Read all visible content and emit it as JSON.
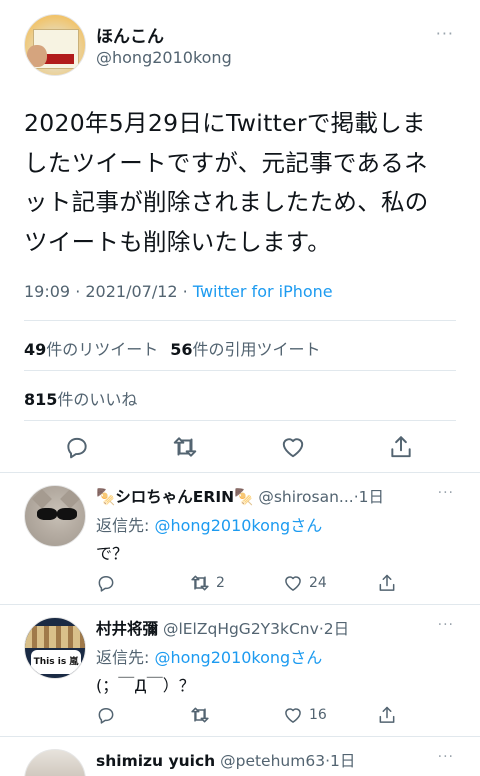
{
  "main_tweet": {
    "display_name": "ほんこん",
    "handle": "@hong2010kong",
    "text_lines": [
      "2020年5月29日にTwitterで掲載しま",
      "したツイートですが、元記事であるネ",
      "ット記事が削除されましたため、私の",
      "ツイートも削除いたします。"
    ],
    "time": "19:09 · 2021/07/12 · ",
    "via": "Twitter for iPhone",
    "retweets_count": "49",
    "retweets_label": "件のリツイート",
    "quotes_count": "56",
    "quotes_label": "件の引用ツイート",
    "likes_count": "815",
    "likes_label": "件のいいね",
    "more": "···"
  },
  "replies": [
    {
      "name": "🍢シロちゃんERIN🍢",
      "handle": "@shirosan...",
      "age": "·1日",
      "reply_to_prefix": "返信先: ",
      "reply_to_handle": "@hong2010kong",
      "reply_to_suffix": "さん",
      "body": "で？",
      "retweets": "2",
      "likes": "24",
      "more": "···"
    },
    {
      "name": "村井将彌",
      "handle": "@lElZqHgG2Y3kCnv",
      "age": "·2日",
      "reply_to_prefix": "返信先: ",
      "reply_to_handle": "@hong2010kong",
      "reply_to_suffix": "さん",
      "body": "(；￣Д￣）？",
      "retweets": "",
      "likes": "16",
      "more": "···",
      "avatar_text": "This is 嵐 LIVE"
    },
    {
      "name": "shimizu yuich",
      "handle": "@petehum63",
      "age": "·1日",
      "more": "···"
    }
  ],
  "colors": {
    "link": "#1d9bf0",
    "secondary_text": "#536471",
    "primary_text": "#0f1419",
    "divider": "#e1e8ed"
  },
  "icons": [
    "reply-icon",
    "retweet-icon",
    "like-icon",
    "share-icon",
    "more-icon"
  ]
}
